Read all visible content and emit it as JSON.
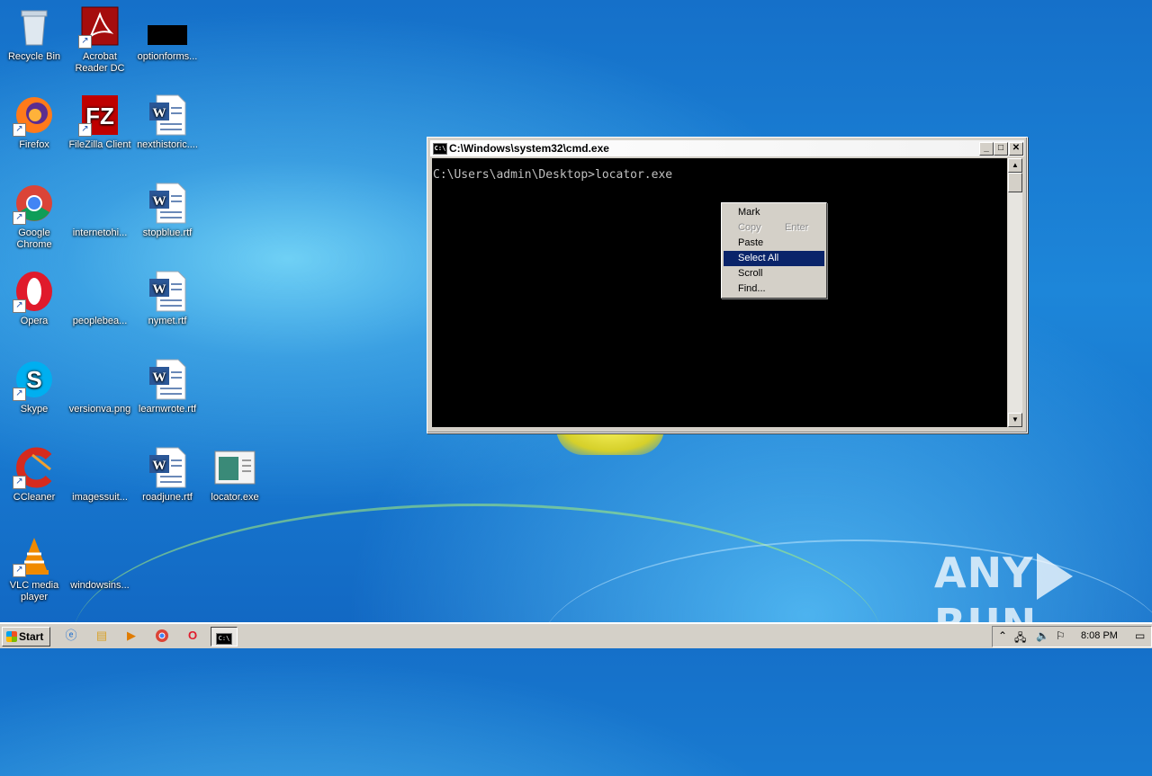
{
  "desktop": {
    "icons": [
      {
        "label": "Recycle Bin",
        "icon": "recycle-bin-icon"
      },
      {
        "label": "Acrobat Reader DC",
        "icon": "acrobat-icon"
      },
      {
        "label": "optionforms...",
        "icon": "black-file-icon"
      },
      {
        "label": "Firefox",
        "icon": "firefox-icon"
      },
      {
        "label": "FileZilla Client",
        "icon": "filezilla-icon"
      },
      {
        "label": "nexthistoric....",
        "icon": "word-doc-icon"
      },
      {
        "label": "Google Chrome",
        "icon": "chrome-icon"
      },
      {
        "label": "internetohi...",
        "icon": "blank-file-icon"
      },
      {
        "label": "stopblue.rtf",
        "icon": "word-doc-icon"
      },
      {
        "label": "Opera",
        "icon": "opera-icon"
      },
      {
        "label": "peoplebea...",
        "icon": "blank-file-icon"
      },
      {
        "label": "nymet.rtf",
        "icon": "word-doc-icon"
      },
      {
        "label": "Skype",
        "icon": "skype-icon"
      },
      {
        "label": "versionva.png",
        "icon": "blank-file-icon"
      },
      {
        "label": "learnwrote.rtf",
        "icon": "word-doc-icon"
      },
      {
        "label": "CCleaner",
        "icon": "ccleaner-icon"
      },
      {
        "label": "imagessuit...",
        "icon": "blank-file-icon"
      },
      {
        "label": "roadjune.rtf",
        "icon": "word-doc-icon"
      },
      {
        "label": "locator.exe",
        "icon": "exe-icon"
      },
      {
        "label": "VLC media player",
        "icon": "vlc-icon"
      },
      {
        "label": "windowsins...",
        "icon": "blank-file-icon"
      }
    ]
  },
  "cmd_window": {
    "title": "C:\\Windows\\system32\\cmd.exe",
    "icon_text": "C:\\",
    "console_line": "C:\\Users\\admin\\Desktop>locator.exe",
    "minimize": "_",
    "maximize": "□",
    "close": "✕"
  },
  "context_menu": {
    "items": [
      {
        "label": "Mark",
        "shortcut": ""
      },
      {
        "label": "Copy",
        "shortcut": "Enter",
        "disabled": true
      },
      {
        "label": "Paste",
        "shortcut": ""
      },
      {
        "label": "Select All",
        "shortcut": "",
        "selected": true
      },
      {
        "label": "Scroll",
        "shortcut": ""
      },
      {
        "label": "Find...",
        "shortcut": ""
      }
    ]
  },
  "watermark": {
    "left": "ANY",
    "right": "RUN"
  },
  "taskbar": {
    "start_label": "Start",
    "clock": "8:08 PM",
    "apps": [
      "ie-icon",
      "explorer-icon",
      "media-player-icon",
      "chrome-icon",
      "opera-icon",
      "cmd-icon"
    ]
  }
}
